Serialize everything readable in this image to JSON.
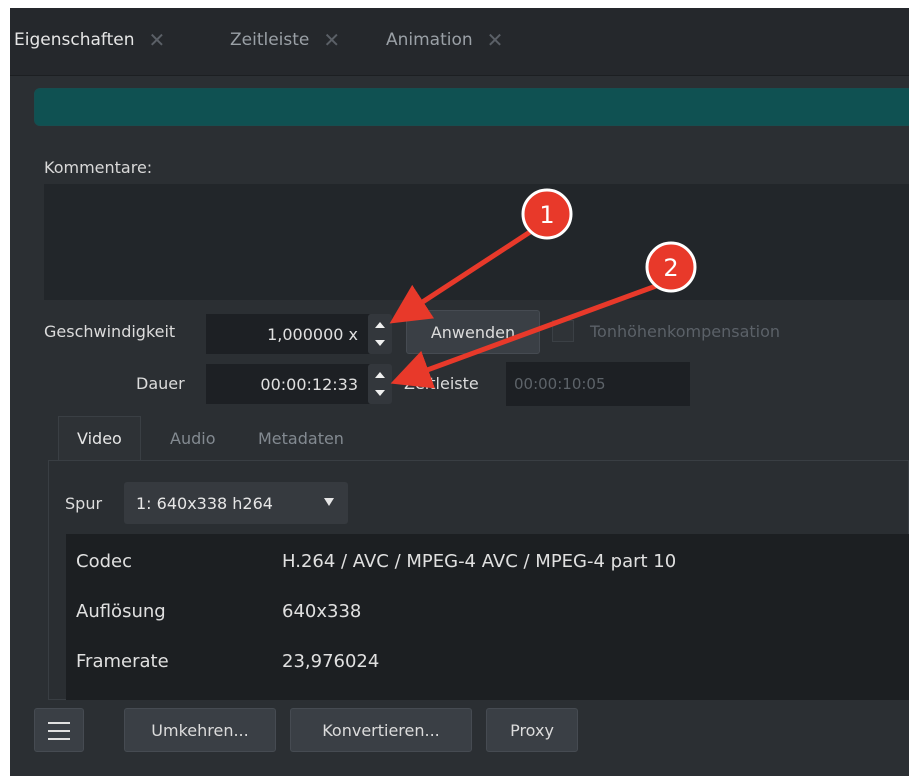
{
  "tabs": [
    {
      "label": "Eigenschaften",
      "active": true
    },
    {
      "label": "Zeitleiste",
      "active": false
    },
    {
      "label": "Animation",
      "active": false
    }
  ],
  "comments": {
    "label": "Kommentare:",
    "value": ""
  },
  "speed": {
    "label": "Geschwindigkeit",
    "value": "1,000000 x",
    "apply_label": "Anwenden",
    "pitch_label": "Tonhöhenkompensation",
    "pitch_checked": false
  },
  "duration": {
    "label": "Dauer",
    "value": "00:00:12:33",
    "timeline_label": "Zeitleiste",
    "timeline_value": "00:00:10:05"
  },
  "inner_tabs": [
    {
      "label": "Video",
      "active": true
    },
    {
      "label": "Audio",
      "active": false
    },
    {
      "label": "Metadaten",
      "active": false
    }
  ],
  "track": {
    "label": "Spur",
    "selected": "1: 640x338 h264"
  },
  "info": [
    {
      "key": "Codec",
      "value": "H.264 / AVC / MPEG-4 AVC / MPEG-4 part 10"
    },
    {
      "key": "Auflösung",
      "value": "640x338"
    },
    {
      "key": "Framerate",
      "value": "23,976024"
    }
  ],
  "toolbar": {
    "reverse_label": "Umkehren...",
    "convert_label": "Konvertieren...",
    "proxy_label": "Proxy"
  },
  "annotations": [
    {
      "number": "1",
      "color": "#e8392a"
    },
    {
      "number": "2",
      "color": "#e8392a"
    }
  ],
  "colors": {
    "accent_teal": "#0f5152",
    "background": "#2b2f33",
    "annotation_red": "#e8392a"
  }
}
